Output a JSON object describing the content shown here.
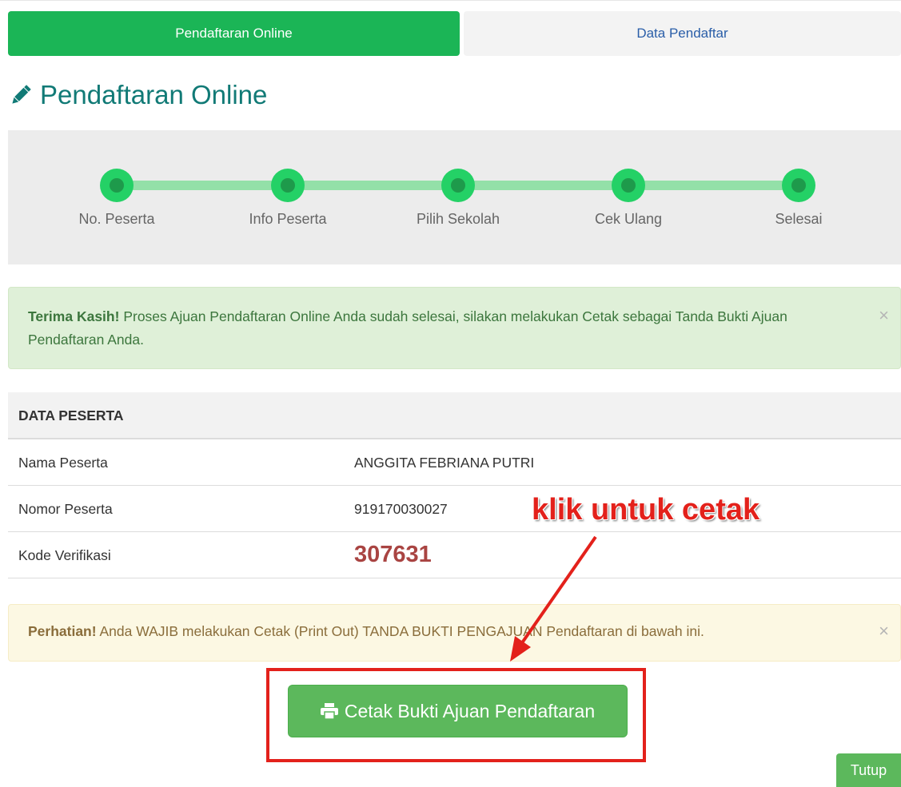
{
  "tabs": [
    {
      "label": "Pendaftaran Online",
      "active": true
    },
    {
      "label": "Data Pendaftar",
      "active": false
    }
  ],
  "page_title": "Pendaftaran Online",
  "steps": [
    {
      "label": "No. Peserta",
      "completed": true
    },
    {
      "label": "Info Peserta",
      "completed": true
    },
    {
      "label": "Pilih Sekolah",
      "completed": true
    },
    {
      "label": "Cek Ulang",
      "completed": true
    },
    {
      "label": "Selesai",
      "completed": true
    }
  ],
  "success_alert": {
    "strong": "Terima Kasih!",
    "message": "Proses Ajuan Pendaftaran Online Anda sudah selesai, silakan melakukan Cetak sebagai Tanda Bukti Ajuan Pendaftaran Anda.",
    "close": "×"
  },
  "data_peserta": {
    "header": "DATA PESERTA",
    "rows": [
      {
        "label": "Nama Peserta",
        "value": "ANGGITA FEBRIANA PUTRI"
      },
      {
        "label": "Nomor Peserta",
        "value": "919170030027"
      },
      {
        "label": "Kode Verifikasi",
        "value": "307631"
      }
    ]
  },
  "annotation": "klik untuk cetak",
  "warning_alert": {
    "strong": "Perhatian!",
    "message": "Anda WAJIB melakukan Cetak (Print Out) TANDA BUKTI PENGAJUAN Pendaftaran di bawah ini.",
    "close": "×"
  },
  "print_button": {
    "label": "Cetak Bukti Ajuan Pendaftaran",
    "icon": "print-icon"
  },
  "close_button": {
    "label": "Tutup"
  },
  "colors": {
    "primary_green": "#1bb556",
    "title_teal": "#117a76",
    "step_green": "#24d166",
    "button_green": "#5cb85c",
    "annotation_red": "#e3211b",
    "code_red": "#a94442"
  }
}
